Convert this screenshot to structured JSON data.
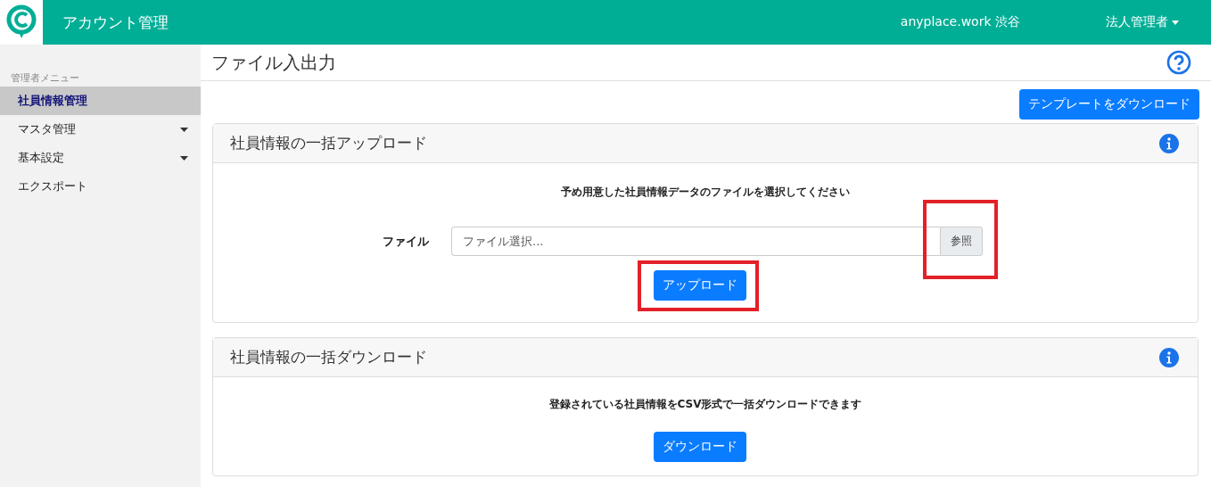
{
  "header": {
    "title": "アカウント管理",
    "location": "anyplace.work 渋谷",
    "user_menu": "法人管理者"
  },
  "sidebar": {
    "heading": "管理者メニュー",
    "items": [
      {
        "label": "社員情報管理",
        "selected": true,
        "has_submenu": false
      },
      {
        "label": "マスタ管理",
        "selected": false,
        "has_submenu": true
      },
      {
        "label": "基本設定",
        "selected": false,
        "has_submenu": true
      },
      {
        "label": "エクスポート",
        "selected": false,
        "has_submenu": false
      }
    ]
  },
  "page": {
    "title": "ファイル入出力",
    "template_button": "テンプレートをダウンロード"
  },
  "upload_card": {
    "title": "社員情報の一括アップロード",
    "instruction": "予め用意した社員情報データのファイルを選択してください",
    "file_label": "ファイル",
    "file_placeholder": "ファイル選択...",
    "browse_button": {
      "label": "参照",
      "highlighted": true
    },
    "upload_button": {
      "label": "アップロード",
      "highlighted": true
    }
  },
  "download_card": {
    "title": "社員情報の一括ダウンロード",
    "instruction": "登録されている社員情報をCSV形式で一括ダウンロードできます",
    "download_button": {
      "label": "ダウンロード"
    }
  }
}
